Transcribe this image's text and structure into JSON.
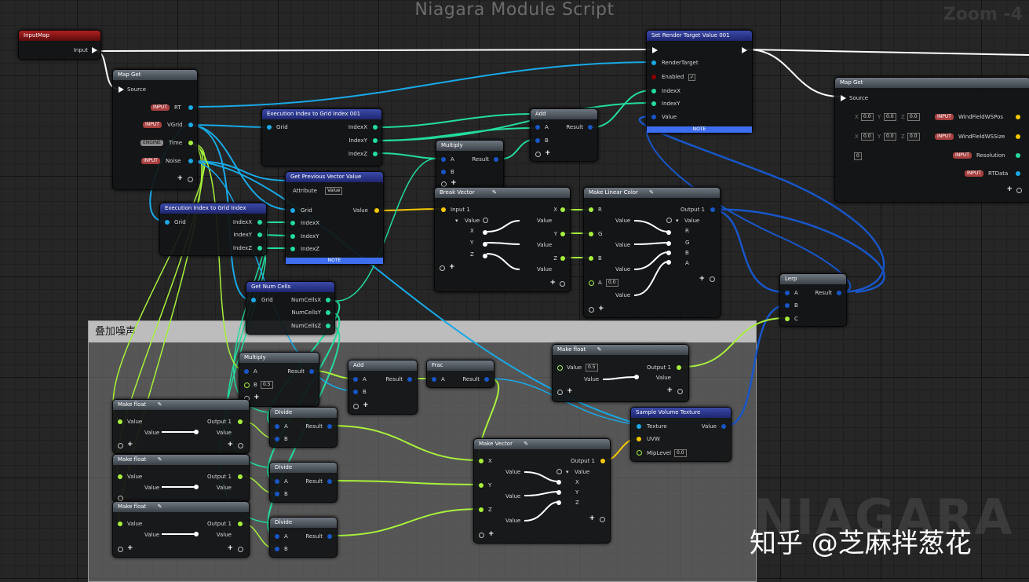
{
  "graph": {
    "title": "Niagara Module Script",
    "zoom": "Zoom -4",
    "watermark": "NIAGARA",
    "credit": "知乎 @芝麻拌葱花"
  },
  "comment": {
    "title": "叠加噪声"
  },
  "nodes": {
    "input_map": {
      "title": "InputMap",
      "input": "Input"
    },
    "map_get": {
      "title": "Map Get",
      "source": "Source",
      "rows": [
        {
          "badge": "INPUT",
          "label": "RT"
        },
        {
          "badge": "INPUT",
          "label": "VGrid"
        },
        {
          "badge": "ENGINE",
          "label": "Time"
        },
        {
          "badge": "INPUT",
          "label": "Noise"
        }
      ]
    },
    "exec_index_1": {
      "title": "Execution Index to Grid Index 001",
      "grid": "Grid",
      "ix": "IndexX",
      "iy": "IndexY",
      "iz": "IndexZ"
    },
    "exec_index_2": {
      "title": "Execution Index to Grid Index",
      "grid": "Grid",
      "ix": "IndexX",
      "iy": "IndexY",
      "iz": "IndexZ"
    },
    "get_prev": {
      "title": "Get Previous Vector Value",
      "attribute": "Attribute",
      "attribute_value": "Value",
      "grid": "Grid",
      "value": "Value",
      "ix": "IndexX",
      "iy": "IndexY",
      "iz": "IndexZ",
      "note": "NOTE"
    },
    "get_num_cells": {
      "title": "Get Num Cells",
      "grid": "Grid",
      "x": "NumCellsX",
      "y": "NumCellsY",
      "z": "NumCellsZ"
    },
    "multiply_top": {
      "title": "Multiply",
      "a": "A",
      "b": "B",
      "result": "Result"
    },
    "add_top": {
      "title": "Add",
      "a": "A",
      "b": "B",
      "result": "Result"
    },
    "set_rt": {
      "title": "Set Render Target Value 001",
      "render_target": "RenderTarget",
      "enabled": "Enabled",
      "ix": "IndexX",
      "iy": "IndexY",
      "value": "Value",
      "note": "NOTE"
    },
    "map_get_2": {
      "title": "Map Get",
      "source": "Source",
      "rows": [
        {
          "badge": "INPUT",
          "label": "WindFieldWSPos"
        },
        {
          "badge": "INPUT",
          "label": "WindFieldWSSize"
        },
        {
          "badge": "INPUT",
          "label": "Resolution"
        },
        {
          "badge": "INPUT",
          "label": "RTData"
        }
      ],
      "defaults": [
        "0.0",
        "0.0",
        "0.0",
        "0"
      ]
    },
    "break_vector": {
      "title": "Break Vector",
      "input": "Input 1",
      "value": "Value",
      "x": "X",
      "y": "Y",
      "z": "Z"
    },
    "make_linear_color": {
      "title": "Make Linear Color",
      "r": "R",
      "g": "G",
      "b": "B",
      "a": "A",
      "a_default": "0.0",
      "output": "Output 1",
      "value": "Value"
    },
    "lerp": {
      "title": "Lerp",
      "a": "A",
      "b": "B",
      "c": "C",
      "result": "Result"
    },
    "make_float_top": {
      "title": "Make float",
      "value": "Value",
      "value_default": "0.5",
      "output": "Output 1"
    },
    "sample_volume": {
      "title": "Sample Volume Texture",
      "texture": "Texture",
      "uvw": "UVW",
      "mip": "MipLevel",
      "mip_default": "0.0",
      "value": "Value"
    },
    "multiply_mid": {
      "title": "Multiply",
      "a": "A",
      "b": "B",
      "b_default": "0.5",
      "result": "Result"
    },
    "add_mid": {
      "title": "Add",
      "a": "A",
      "b": "B",
      "result": "Result"
    },
    "frac": {
      "title": "Frac",
      "a": "A",
      "result": "Result"
    },
    "make_float_1": {
      "title": "Make float",
      "value": "Value",
      "output": "Output 1"
    },
    "make_float_2": {
      "title": "Make float",
      "value": "Value",
      "output": "Output 1"
    },
    "make_float_3": {
      "title": "Make float",
      "value": "Value",
      "output": "Output 1"
    },
    "divide_1": {
      "title": "Divide",
      "a": "A",
      "b": "B",
      "result": "Result"
    },
    "divide_2": {
      "title": "Divide",
      "a": "A",
      "b": "B",
      "result": "Result"
    },
    "divide_3": {
      "title": "Divide",
      "a": "A",
      "b": "B",
      "result": "Result"
    },
    "make_vector": {
      "title": "Make Vector",
      "x": "X",
      "y": "Y",
      "z": "Z",
      "output": "Output 1",
      "value": "Value"
    }
  },
  "colors": {
    "float": "#a7f03c",
    "vector": "#f5c800",
    "int": "#23dca0",
    "object": "#19a9e6",
    "linear_color": "#1856c8",
    "note": "#3e6ef0"
  }
}
